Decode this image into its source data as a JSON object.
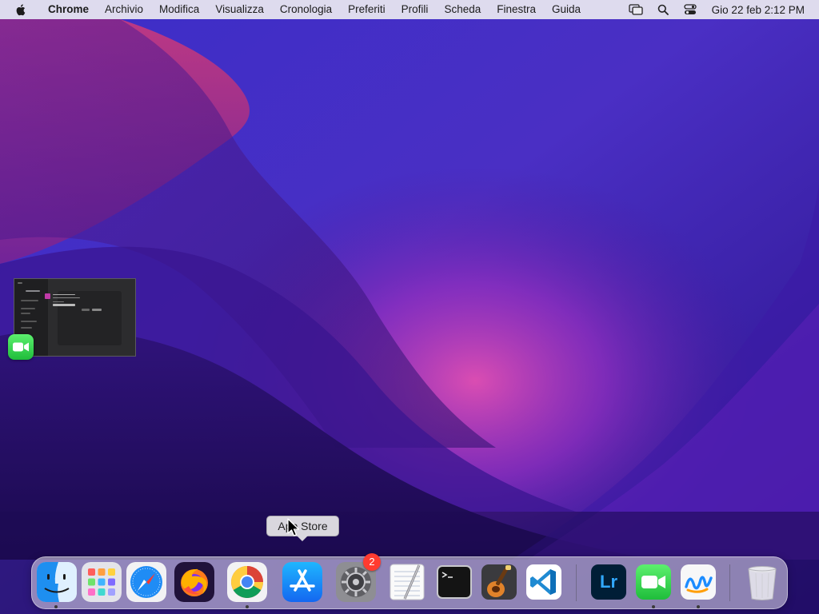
{
  "menubar": {
    "app_name": "Chrome",
    "items": [
      "Archivio",
      "Modifica",
      "Visualizza",
      "Cronologia",
      "Preferiti",
      "Profili",
      "Scheda",
      "Finestra",
      "Guida"
    ],
    "clock": "Gio 22 feb  2:12 PM",
    "status_icons": [
      "screen-mirroring-icon",
      "spotlight-search-icon",
      "control-center-icon"
    ]
  },
  "tooltip": {
    "text": "App Store"
  },
  "dock": {
    "apps": [
      {
        "name": "Finder",
        "icon": "finder-icon",
        "running": true
      },
      {
        "name": "Launchpad",
        "icon": "launchpad-icon",
        "running": false
      },
      {
        "name": "Safari",
        "icon": "safari-icon",
        "running": false
      },
      {
        "name": "Firefox",
        "icon": "firefox-icon",
        "running": false
      },
      {
        "name": "Chrome",
        "icon": "chrome-icon",
        "running": true
      },
      {
        "name": "App Store",
        "icon": "app-store-icon",
        "running": false
      },
      {
        "name": "System Preferences",
        "icon": "system-preferences-icon",
        "running": false,
        "badge": "2"
      },
      {
        "name": "TextEdit",
        "icon": "textedit-icon",
        "running": false
      },
      {
        "name": "Terminal",
        "icon": "terminal-icon",
        "running": false
      },
      {
        "name": "GarageBand",
        "icon": "garageband-icon",
        "running": false
      },
      {
        "name": "Visual Studio Code",
        "icon": "vscode-icon",
        "running": false
      },
      {
        "name": "Lightroom",
        "icon": "lightroom-icon",
        "running": false
      },
      {
        "name": "FaceTime",
        "icon": "facetime-icon",
        "running": true
      },
      {
        "name": "Freeform",
        "icon": "freeform-icon",
        "running": true
      },
      {
        "name": "Trash",
        "icon": "trash-icon",
        "running": false
      }
    ],
    "lightroom_label": "Lr"
  },
  "colors": {
    "menubar_bg": "#ECEAF1",
    "badge_red": "#FF3B30",
    "wallpaper_deep": "#1A0B4A",
    "wallpaper_magenta": "#C0389A"
  }
}
